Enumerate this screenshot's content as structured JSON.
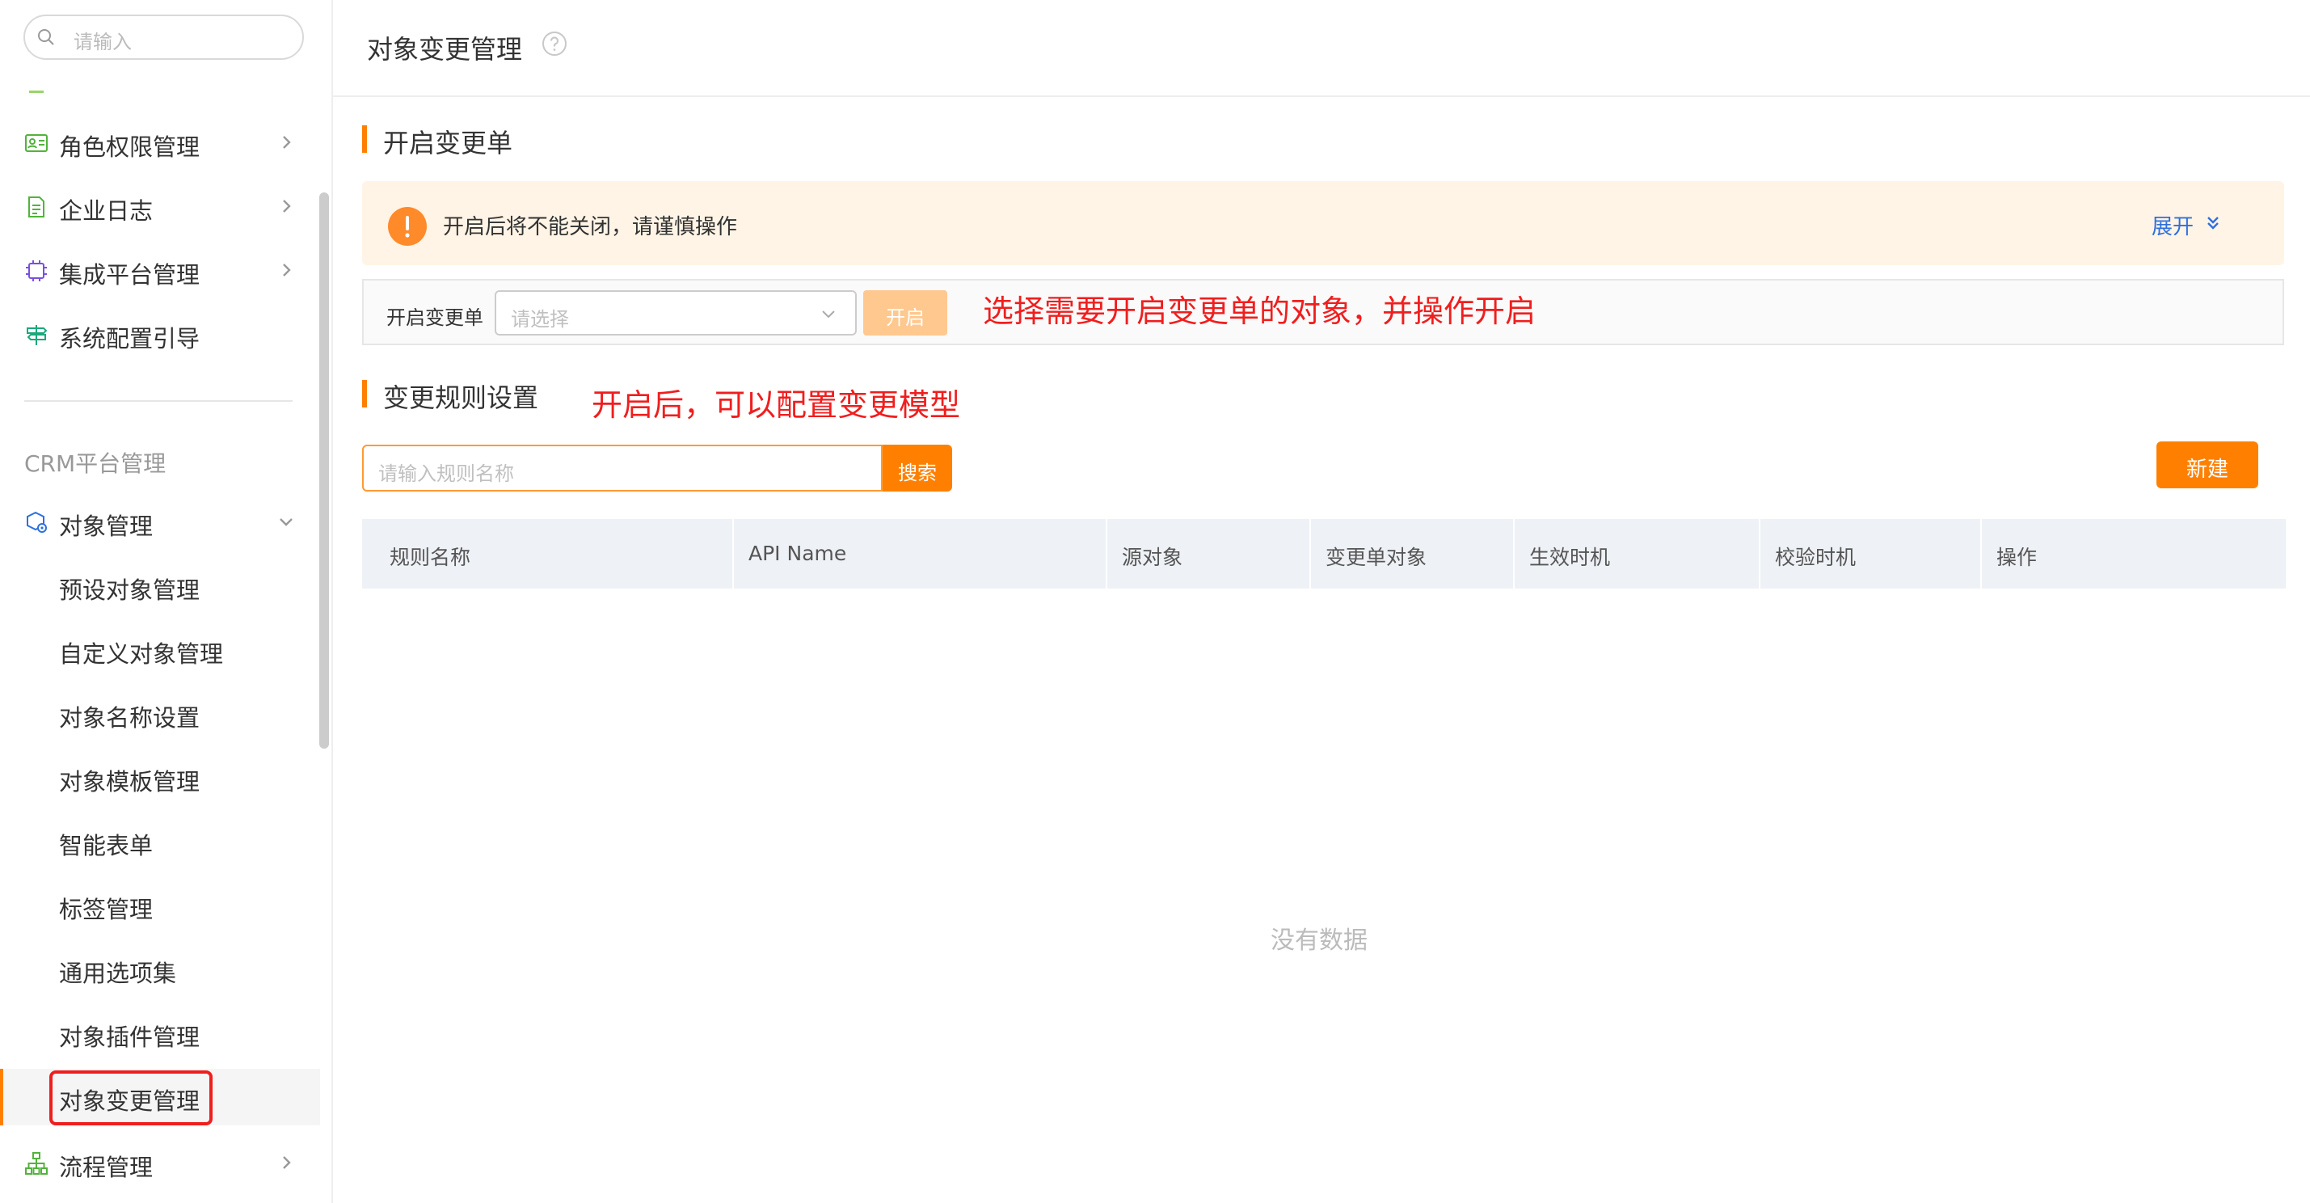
{
  "sidebar": {
    "search_placeholder": "请输入",
    "top_items": [
      {
        "label": "角色权限管理",
        "icon": "id-card-icon"
      },
      {
        "label": "企业日志",
        "icon": "document-log-icon"
      },
      {
        "label": "集成平台管理",
        "icon": "chip-icon"
      },
      {
        "label": "系统配置引导",
        "icon": "signpost-icon"
      }
    ],
    "group_title": "CRM平台管理",
    "object_mgmt": {
      "label": "对象管理",
      "icon": "object-settings-icon",
      "expanded": true
    },
    "sub_items": [
      {
        "label": "预设对象管理"
      },
      {
        "label": "自定义对象管理"
      },
      {
        "label": "对象名称设置"
      },
      {
        "label": "对象模板管理"
      },
      {
        "label": "智能表单"
      },
      {
        "label": "标签管理"
      },
      {
        "label": "通用选项集"
      },
      {
        "label": "对象插件管理"
      },
      {
        "label": "对象变更管理",
        "active": true
      }
    ],
    "process_mgmt": {
      "label": "流程管理",
      "icon": "flow-tree-icon"
    }
  },
  "header": {
    "title": "对象变更管理",
    "help_icon": "question-circle-icon"
  },
  "open_section": {
    "title": "开启变更单",
    "warning_text": "开启后将不能关闭，请谨慎操作",
    "expand_label": "展开",
    "field_label": "开启变更单",
    "select_placeholder": "请选择",
    "open_button": "开启"
  },
  "annotations": {
    "select_hint": "选择需要开启变更单的对象，并操作开启",
    "rules_hint": "开启后，可以配置变更模型"
  },
  "rules_section": {
    "title": "变更规则设置",
    "search_placeholder": "请输入规则名称",
    "search_button": "搜索",
    "new_button": "新建",
    "columns": [
      "规则名称",
      "API Name",
      "源对象",
      "变更单对象",
      "生效时机",
      "校验时机",
      "操作"
    ],
    "empty_text": "没有数据"
  },
  "colors": {
    "accent": "#ff8000",
    "annotation": "#f01e1e",
    "link": "#2f6fde"
  }
}
